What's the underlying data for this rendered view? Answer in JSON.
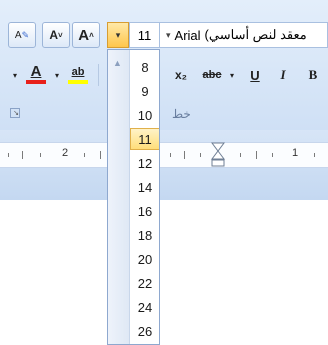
{
  "toolbar": {
    "font_size": "11",
    "font_name": "Arial",
    "font_name_suffix": "معقد لنص أساسي)",
    "dropdown_arrow": "▾",
    "clear_format_label": "A",
    "grow_font_label": "A",
    "shrink_font_label": "A",
    "font_color_label": "A",
    "highlight_label": "ab",
    "subscript_label": "x₂",
    "strikethrough_label": "abc",
    "underline_label": "U",
    "italic_label": "I",
    "bold_label": "B",
    "font_color": "#e8201a",
    "highlight_color": "#ffff00"
  },
  "group": {
    "label": "خط"
  },
  "ruler": {
    "numbers": [
      "2",
      "1"
    ]
  },
  "font_size_dropdown": {
    "options": [
      "8",
      "9",
      "10",
      "11",
      "12",
      "14",
      "16",
      "18",
      "20",
      "22",
      "24",
      "26"
    ],
    "selected": "11"
  },
  "colors": {
    "accent": "#ffc64c",
    "ribbon": "#d7e5f7"
  }
}
